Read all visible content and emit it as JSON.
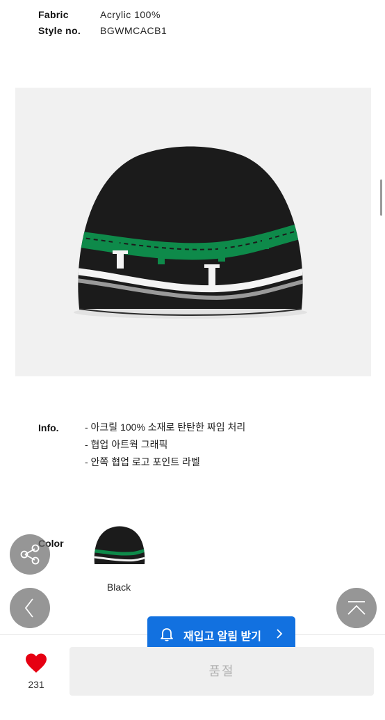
{
  "specs": {
    "fabric_label": "Fabric",
    "fabric_value": "Acrylic 100%",
    "style_label": "Style no.",
    "style_value": "BGWMCACB1"
  },
  "info": {
    "label": "Info.",
    "items": [
      "- 아크릴 100% 소재로 탄탄한 짜임 처리",
      "- 협업 아트웍 그래픽",
      "- 안쪽 협업 로고 포인트 라벨"
    ]
  },
  "color": {
    "label": "Color",
    "options": [
      {
        "name": "Black"
      }
    ]
  },
  "restock": {
    "label": "재입고 알림 받기",
    "icon": "bell-icon",
    "arrow": "chevron-right-icon"
  },
  "like": {
    "count": "231",
    "icon": "heart-icon",
    "color": "#e60012"
  },
  "purchase": {
    "label": "품절"
  },
  "controls": {
    "share": "share-icon",
    "back": "chevron-left-icon",
    "top": "scroll-top-icon"
  },
  "colors": {
    "accent": "#1271e0",
    "soldout_bg": "#efefef",
    "soldout_text": "#b2b2b2",
    "beanie_green": "#0e8a4a"
  }
}
